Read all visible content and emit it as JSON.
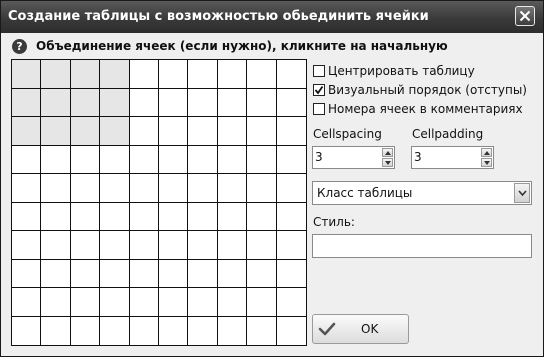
{
  "window": {
    "title": "Создание таблицы с возможностью обьединить ячейки"
  },
  "header": {
    "help_icon": "help-icon",
    "instruction": "Объединение ячеек (если нужно), кликните на начальную"
  },
  "grid": {
    "columns": 10,
    "rows": 10,
    "selected_columns": 4,
    "selected_rows": 3
  },
  "options": {
    "center_table": {
      "label": "Центрировать таблицу",
      "checked": false
    },
    "visual_order": {
      "label": "Визуальный порядок (отступы)",
      "checked": true
    },
    "cell_numbers": {
      "label": "Номера ячеек в комментариях",
      "checked": false
    }
  },
  "cellspacing": {
    "label": "Cellspacing",
    "value": "3"
  },
  "cellpadding": {
    "label": "Cellpadding",
    "value": "3"
  },
  "table_class": {
    "selected": "Класс таблицы"
  },
  "style": {
    "label": "Стиль:",
    "value": ""
  },
  "ok_button": {
    "label": "OK",
    "icon": "checkmark-icon"
  },
  "colors": {
    "titlebar": "#3a3a3a",
    "dialog_bg": "#efefef",
    "selected_cell": "#e6e6e6"
  }
}
